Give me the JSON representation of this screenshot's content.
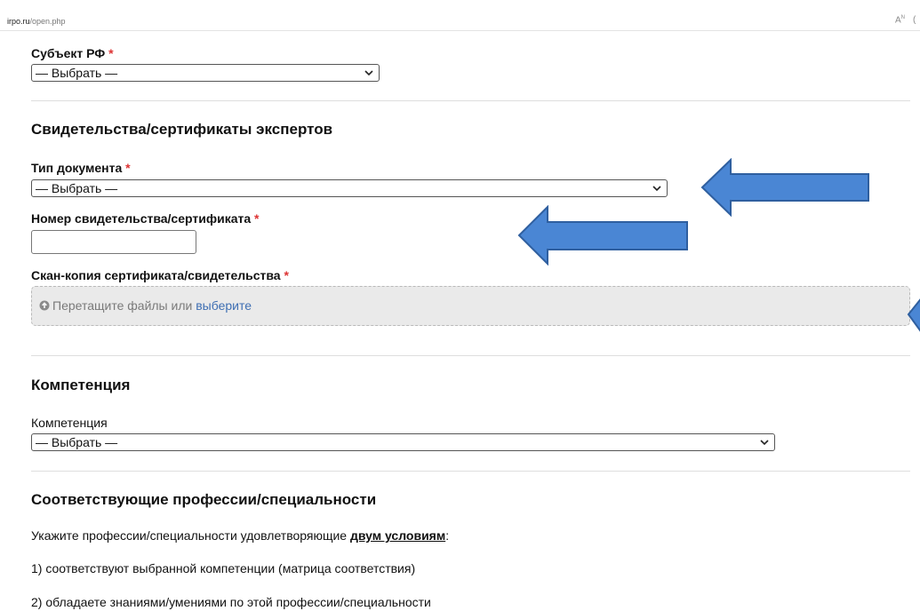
{
  "browser": {
    "url_domain": "irpo.ru",
    "url_path": "/open.php",
    "reader_icon_label": "A",
    "reader_icon_sup": "N",
    "edge_glyph": "("
  },
  "required_mark": "*",
  "region": {
    "label": "Субъект РФ",
    "select_value": "— Выбрать —"
  },
  "certificates": {
    "title": "Свидетельства/сертификаты экспертов",
    "doc_type_label": "Тип документа",
    "doc_type_value": "— Выбрать —",
    "number_label": "Номер свидетельства/сертификата",
    "number_value": "",
    "scan_label": "Скан-копия сертификата/свидетельства",
    "dropzone_text": "Перетащите файлы или",
    "dropzone_link": "выберите"
  },
  "competence": {
    "title": "Компетенция",
    "field_label": "Компетенция",
    "select_value": "— Выбрать —"
  },
  "professions": {
    "title": "Соответствующие профессии/специальности",
    "intro_prefix": "Укажите профессии/специальности удовлетворяющие",
    "intro_emphasis": "двум условиям",
    "intro_suffix": ":",
    "condition_1": "1) соответствуют выбранной компетенции (матрица соответствия)",
    "condition_2": "2) обладаете знаниями/умениями по этой профессии/специальности"
  },
  "annotations": {
    "arrow_color": "#4a86d4",
    "arrow_border": "#2f5f9f"
  }
}
